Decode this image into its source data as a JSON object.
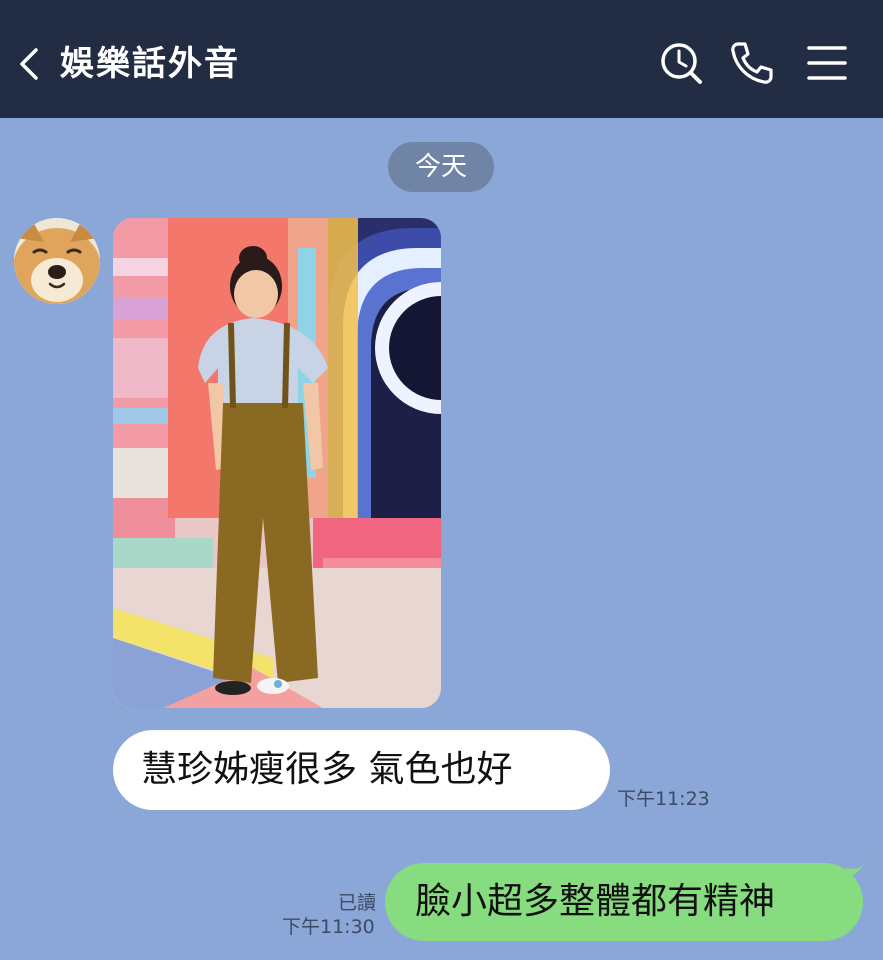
{
  "header": {
    "title": "娛樂話外音",
    "icons": [
      "chevron-left-icon",
      "search-clock-icon",
      "phone-icon",
      "menu-icon"
    ],
    "background": "#222c43"
  },
  "chat": {
    "background": "#8ba7d7",
    "date_label": "今天",
    "messages": [
      {
        "direction": "incoming",
        "type": "image",
        "description_icon": "photo"
      },
      {
        "direction": "incoming",
        "type": "text",
        "text": "慧珍姊瘦很多 氣色也好",
        "time": "下午11:23"
      },
      {
        "direction": "outgoing",
        "type": "text",
        "text": "臉小超多整體都有精神",
        "read_label": "已讀",
        "time": "下午11:30"
      }
    ],
    "colors": {
      "outgoing_bubble": "#86dc7e",
      "incoming_bubble": "#ffffff",
      "date_pill": "#7084a6"
    }
  }
}
